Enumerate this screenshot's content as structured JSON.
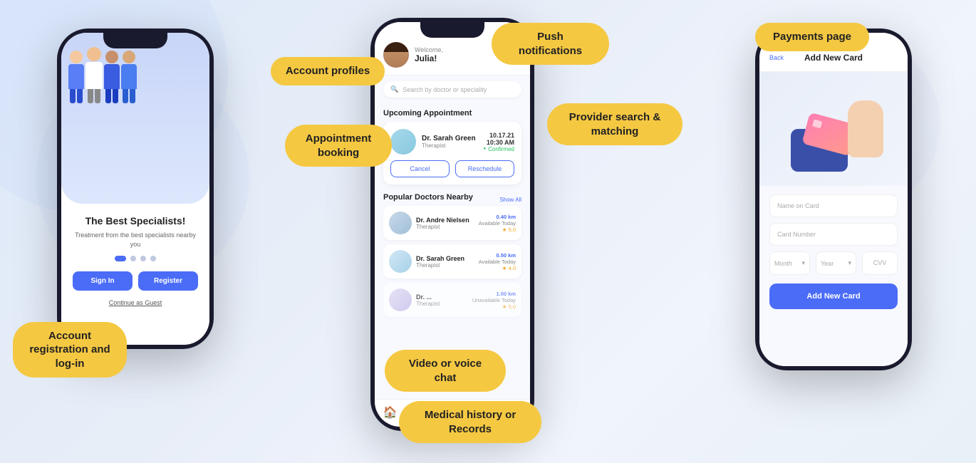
{
  "background": {
    "gradient_start": "#dce8f8",
    "gradient_end": "#e8f0f8"
  },
  "bubbles": {
    "account_registration": "Account registration\nand log-in",
    "account_profiles": "Account profiles",
    "appointment_booking": "Appointment\nbooking",
    "push_notifications": "Push notifications",
    "provider_search": "Provider search & matching",
    "video_chat": "Video or voice chat",
    "medical_history": "Medical history or Records",
    "payments_page": "Payments page"
  },
  "phone1": {
    "title": "The Best Specialists!",
    "subtitle": "Treatment from the best specialists nearby you",
    "signin_label": "Sign In",
    "register_label": "Register",
    "guest_label": "Continue as Guest"
  },
  "phone2": {
    "welcome_text": "Welcome,",
    "user_name": "Julia!",
    "search_placeholder": "Search by doctor or speciality",
    "upcoming_section": "Upcoming Appointment",
    "doctor1_name": "Dr. Sarah Green",
    "doctor1_spec": "Therapist",
    "appointment_date": "10.17.21",
    "appointment_time": "10:30 AM",
    "appointment_status": "Confirmed",
    "cancel_label": "Cancel",
    "reschedule_label": "Reschedule",
    "nearby_section": "Popular Doctors Nearby",
    "show_all_label": "Show All",
    "nearby_doctor1_name": "Dr. Andre Nielsen",
    "nearby_doctor1_spec": "Therapist",
    "nearby_doctor1_dist": "0.40 km",
    "nearby_doctor1_avail": "Available Today",
    "nearby_doctor1_rating": "★ 5.0",
    "nearby_doctor2_name": "Dr. Sarah Green",
    "nearby_doctor2_spec": "Therapist",
    "nearby_doctor2_dist": "0.50 km",
    "nearby_doctor2_avail": "Available Today",
    "nearby_doctor2_rating": "★ 4.0",
    "nearby_doctor3_dist": "1.00 km",
    "nearby_doctor3_avail": "Unavailable Today",
    "nearby_doctor3_rating": "★ 5.0"
  },
  "phone3": {
    "back_label": "Back",
    "title": "Add New Card",
    "name_placeholder": "Name on Card",
    "card_placeholder": "Card Number",
    "month_placeholder": "Month",
    "year_placeholder": "Year",
    "cvv_placeholder": "CVV",
    "add_button_label": "Add New Card"
  }
}
